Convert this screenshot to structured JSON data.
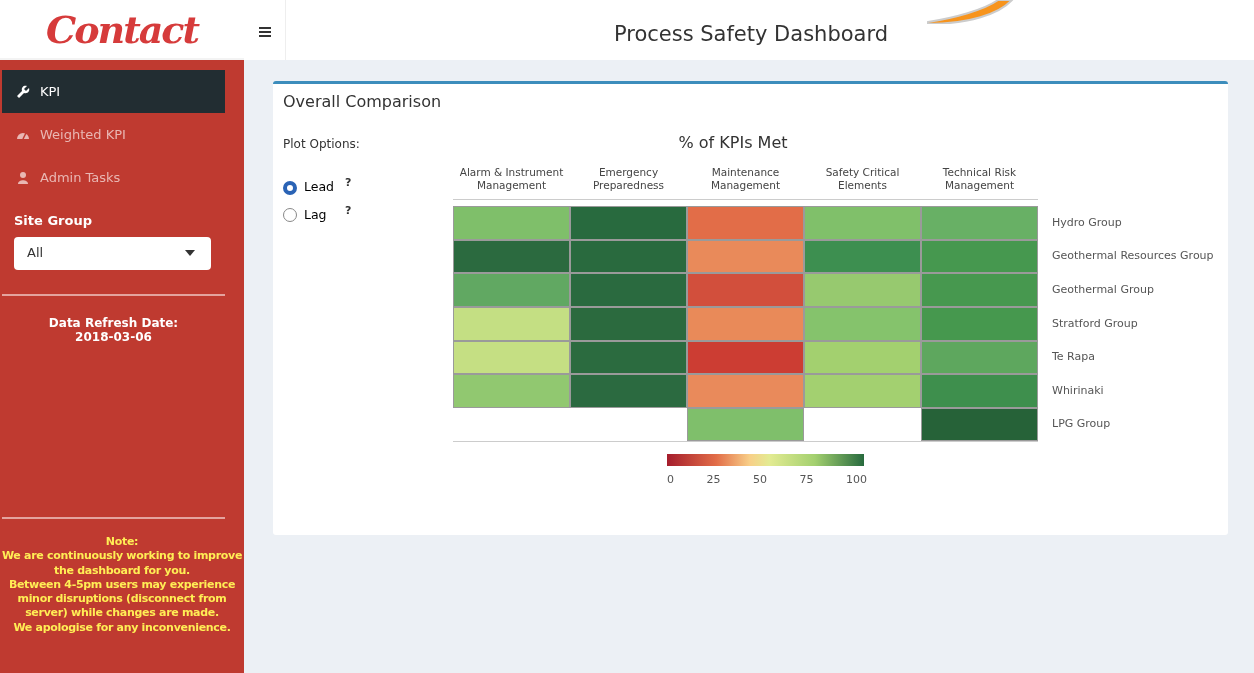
{
  "logo": {
    "text": "Contact"
  },
  "header": {
    "title": "Process Safety Dashboard"
  },
  "sidebar": {
    "items": [
      {
        "label": "KPI",
        "kind": "wrench",
        "selected": true
      },
      {
        "label": "Weighted KPI",
        "kind": "gauge",
        "selected": false
      },
      {
        "label": "Admin Tasks",
        "kind": "user",
        "selected": false
      }
    ],
    "site_group": {
      "label": "Site Group",
      "value": "All"
    },
    "refresh": {
      "label": "Data Refresh Date:",
      "date": "2018-03-06"
    },
    "note": [
      "Note:",
      "We are continuously working to improve the dashboard for you.",
      "Between 4-5pm users may experience minor disruptions (disconnect from server) while changes are made.",
      "We apologise for any inconvenience."
    ]
  },
  "panel": {
    "title": "Overall Comparison",
    "plot_options": {
      "label": "Plot Options:",
      "options": [
        {
          "label": "Lead",
          "help": "?",
          "selected": true
        },
        {
          "label": "Lag",
          "help": "?",
          "selected": false
        }
      ]
    },
    "heatmap": {
      "title": "% of KPIs Met",
      "columns": [
        "Alarm & Instrument Management",
        "Emergency Preparedness",
        "Maintenance Management",
        "Safety Critical Elements",
        "Technical Risk Management"
      ],
      "rows": [
        {
          "name": "Hydro Group",
          "cells": [
            {
              "color": "#7fbf6a"
            },
            {
              "color": "#286a3e"
            },
            {
              "color": "#e26d48"
            },
            {
              "color": "#80c06a"
            },
            {
              "color": "#68b065"
            }
          ]
        },
        {
          "name": "Geothermal Resources Group",
          "cells": [
            {
              "color": "#2b6a3f"
            },
            {
              "color": "#296a3e"
            },
            {
              "color": "#e98a5a"
            },
            {
              "color": "#3d8f50"
            },
            {
              "color": "#46984f"
            }
          ]
        },
        {
          "name": "Geothermal Group",
          "cells": [
            {
              "color": "#61a862"
            },
            {
              "color": "#2a6a3f"
            },
            {
              "color": "#d24f3c"
            },
            {
              "color": "#97c96f"
            },
            {
              "color": "#47984f"
            }
          ]
        },
        {
          "name": "Stratford Group",
          "cells": [
            {
              "color": "#c4df83"
            },
            {
              "color": "#2b6a3e"
            },
            {
              "color": "#e98a59"
            },
            {
              "color": "#85c36c"
            },
            {
              "color": "#46984e"
            }
          ]
        },
        {
          "name": "Te Rapa",
          "cells": [
            {
              "color": "#c5df83"
            },
            {
              "color": "#2b6b3f"
            },
            {
              "color": "#cc3d33"
            },
            {
              "color": "#a3d06f"
            },
            {
              "color": "#5ea75e"
            }
          ]
        },
        {
          "name": "Whirinaki",
          "cells": [
            {
              "color": "#91c870"
            },
            {
              "color": "#2b6a40"
            },
            {
              "color": "#e98a5b"
            },
            {
              "color": "#a3d070"
            },
            {
              "color": "#3e8f4d"
            }
          ]
        },
        {
          "name": "LPG Group",
          "cells": [
            null,
            null,
            {
              "color": "#7fbf6b"
            },
            null,
            {
              "color": "#266238"
            }
          ]
        }
      ],
      "legend": {
        "ticks": [
          "0",
          "25",
          "50",
          "75",
          "100"
        ]
      }
    }
  }
}
